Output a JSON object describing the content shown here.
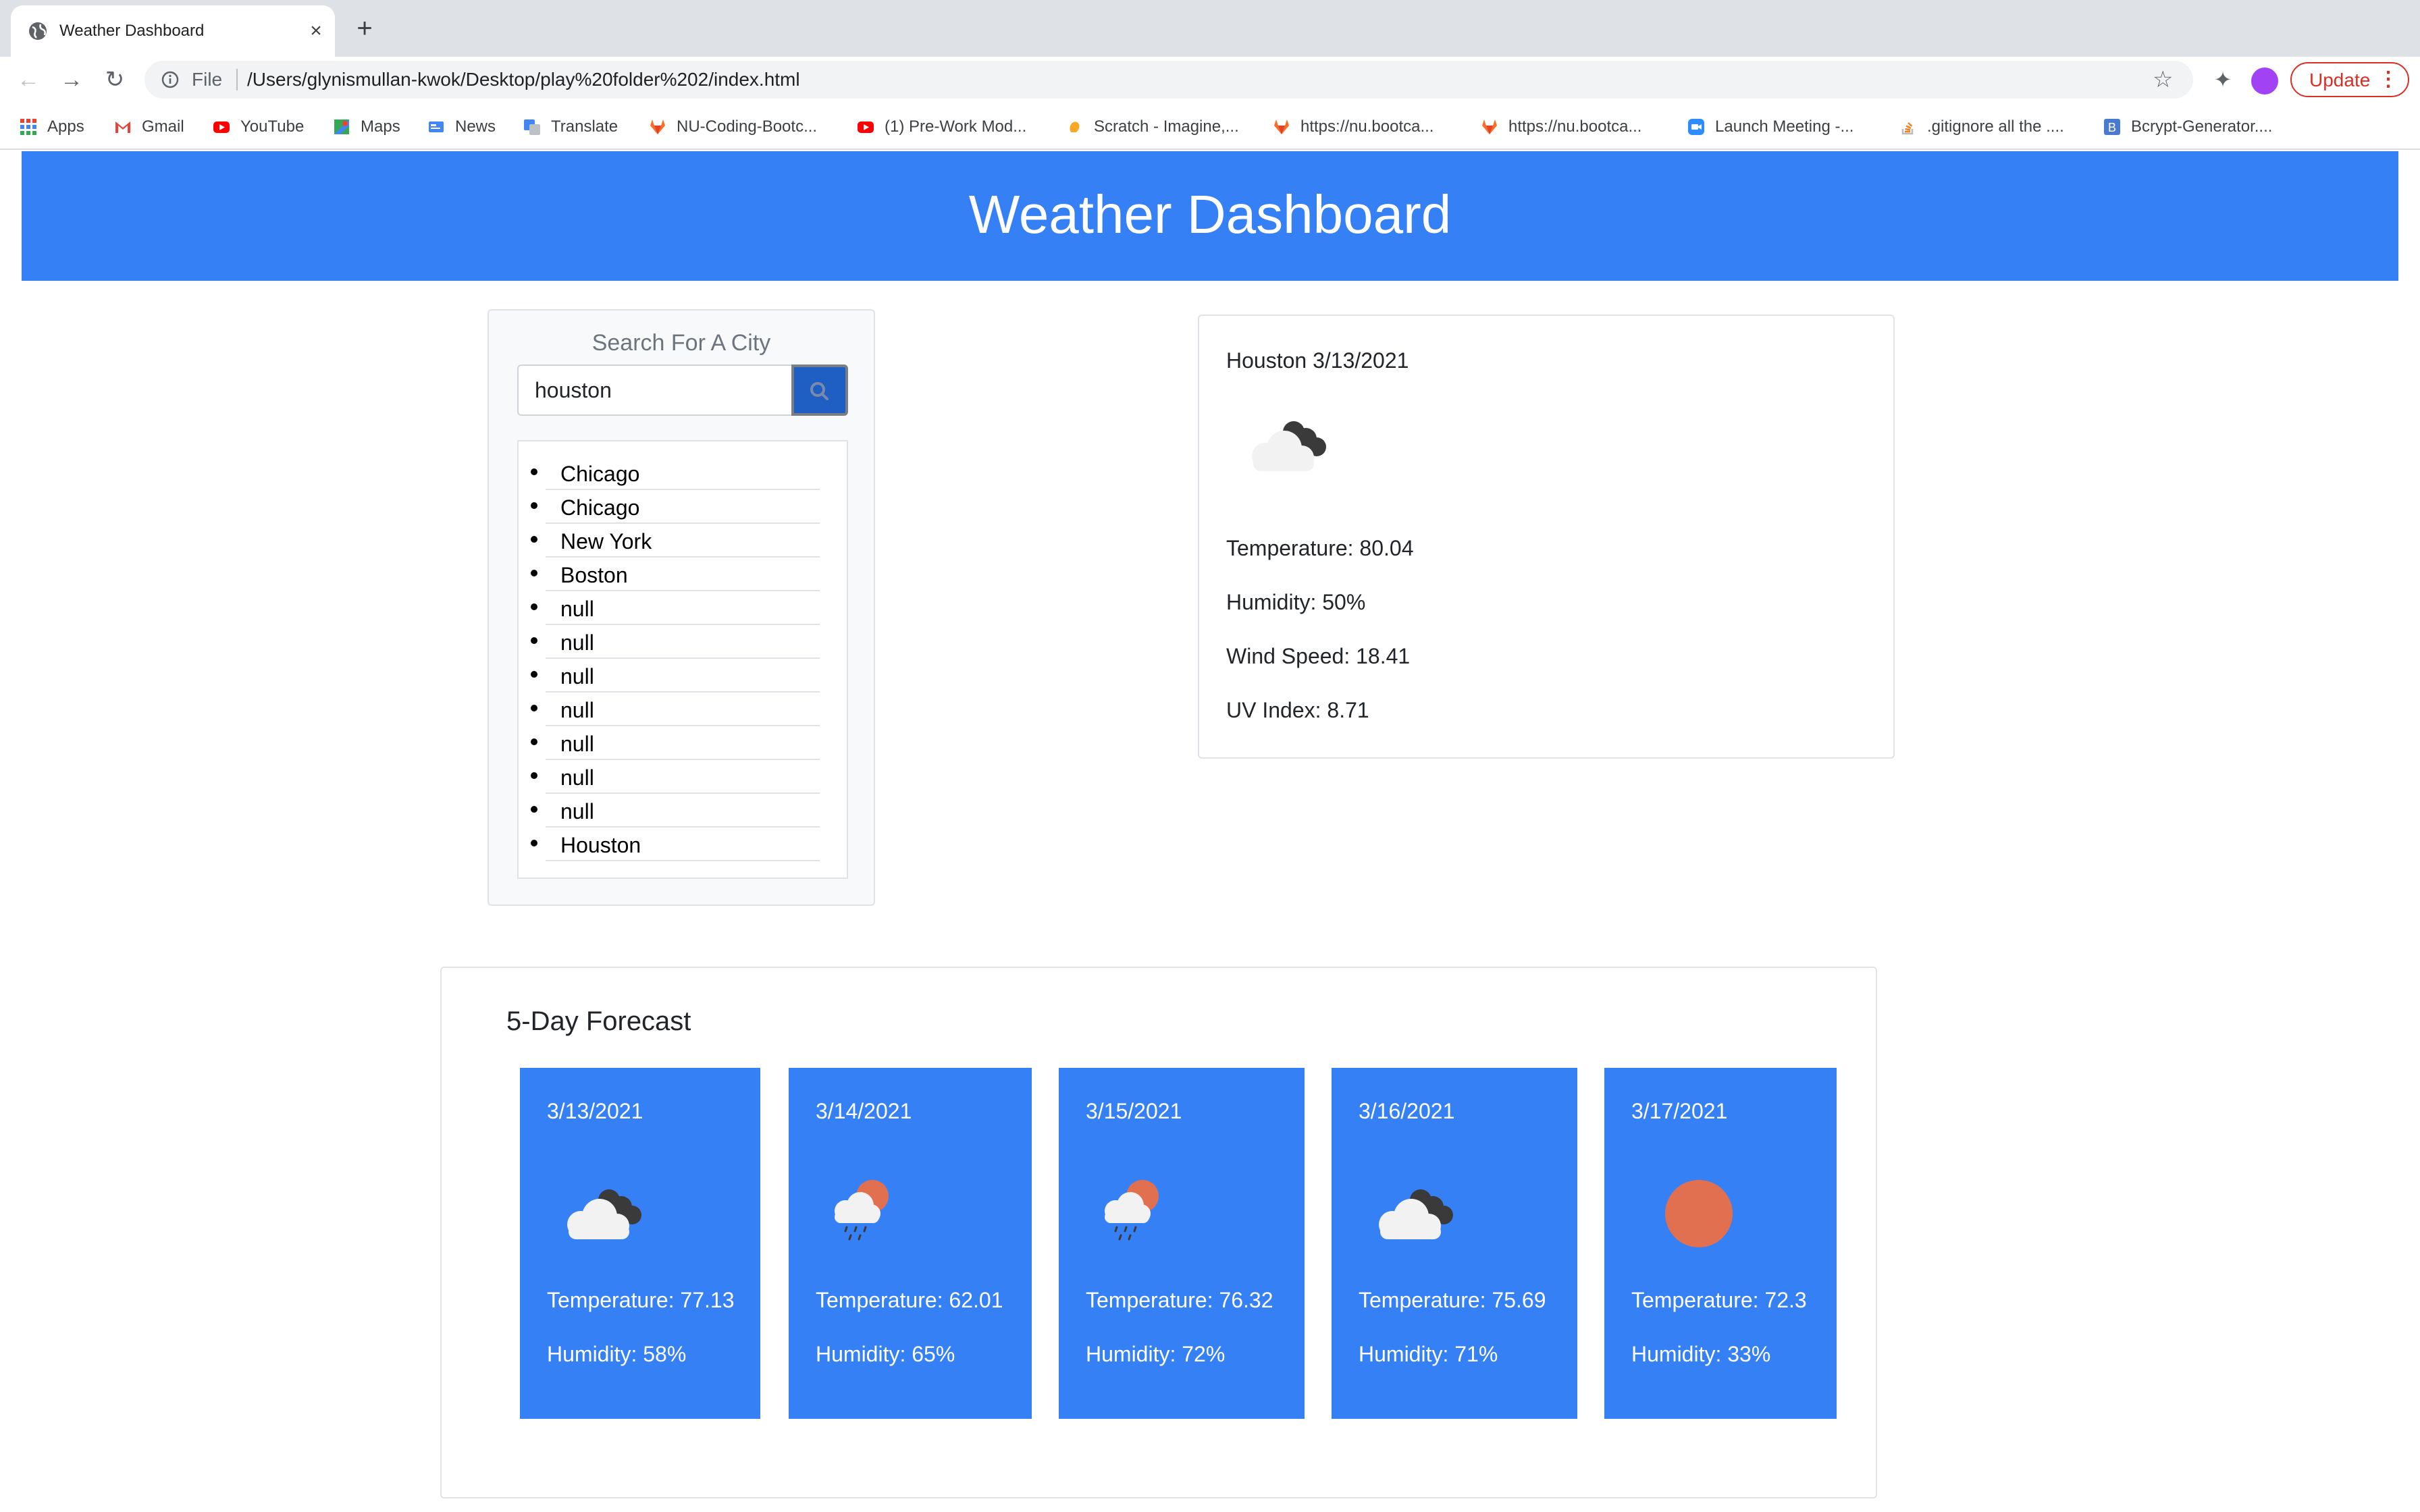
{
  "browser": {
    "tab_title": "Weather Dashboard",
    "url_scheme": "File",
    "url": "/Users/glynismullan-kwok/Desktop/play%20folder%202/index.html",
    "update_label": "Update"
  },
  "bookmarks": [
    {
      "label": "Apps",
      "icon": "apps-grid-icon"
    },
    {
      "label": "Gmail",
      "icon": "gmail-icon"
    },
    {
      "label": "YouTube",
      "icon": "youtube-icon"
    },
    {
      "label": "Maps",
      "icon": "maps-icon"
    },
    {
      "label": "News",
      "icon": "news-icon"
    },
    {
      "label": "Translate",
      "icon": "translate-icon"
    },
    {
      "label": "NU-Coding-Bootc...",
      "icon": "gitlab-icon"
    },
    {
      "label": "(1) Pre-Work Mod...",
      "icon": "youtube-icon"
    },
    {
      "label": "Scratch - Imagine,...",
      "icon": "scratch-icon"
    },
    {
      "label": "https://nu.bootca...",
      "icon": "gitlab-icon"
    },
    {
      "label": "https://nu.bootca...",
      "icon": "gitlab-icon"
    },
    {
      "label": "Launch Meeting -...",
      "icon": "zoom-icon"
    },
    {
      "label": ".gitignore all the ....",
      "icon": "stackoverflow-icon"
    },
    {
      "label": "Bcrypt-Generator....",
      "icon": "bcrypt-icon"
    }
  ],
  "header": {
    "title": "Weather Dashboard"
  },
  "search": {
    "heading": "Search For A City",
    "input_value": "houston",
    "history": [
      "Chicago",
      "Chicago",
      "New York",
      "Boston",
      "null",
      "null",
      "null",
      "null",
      "null",
      "null",
      "null",
      "Houston"
    ]
  },
  "current": {
    "title": "Houston 3/13/2021",
    "icon": "broken-clouds-icon",
    "temperature": "Temperature: 80.04",
    "humidity": "Humidity: 50%",
    "wind": "Wind Speed: 18.41",
    "uv": "UV Index: 8.71"
  },
  "forecast": {
    "heading": "5-Day Forecast",
    "days": [
      {
        "date": "3/13/2021",
        "icon": "broken-clouds-icon",
        "temperature": "Temperature: 77.13",
        "humidity": "Humidity: 58%"
      },
      {
        "date": "3/14/2021",
        "icon": "rain-sun-icon",
        "temperature": "Temperature: 62.01",
        "humidity": "Humidity: 65%"
      },
      {
        "date": "3/15/2021",
        "icon": "rain-sun-icon",
        "temperature": "Temperature: 76.32",
        "humidity": "Humidity: 72%"
      },
      {
        "date": "3/16/2021",
        "icon": "broken-clouds-icon",
        "temperature": "Temperature: 75.69",
        "humidity": "Humidity: 71%"
      },
      {
        "date": "3/17/2021",
        "icon": "clear-sun-icon",
        "temperature": "Temperature: 72.3",
        "humidity": "Humidity: 33%"
      }
    ]
  },
  "colors": {
    "primary": "#3680f5",
    "search_button": "#1f5fc4",
    "sun": "#e07050",
    "cloud_dark": "#3a3a3a",
    "cloud_light": "#f2f2f2"
  }
}
